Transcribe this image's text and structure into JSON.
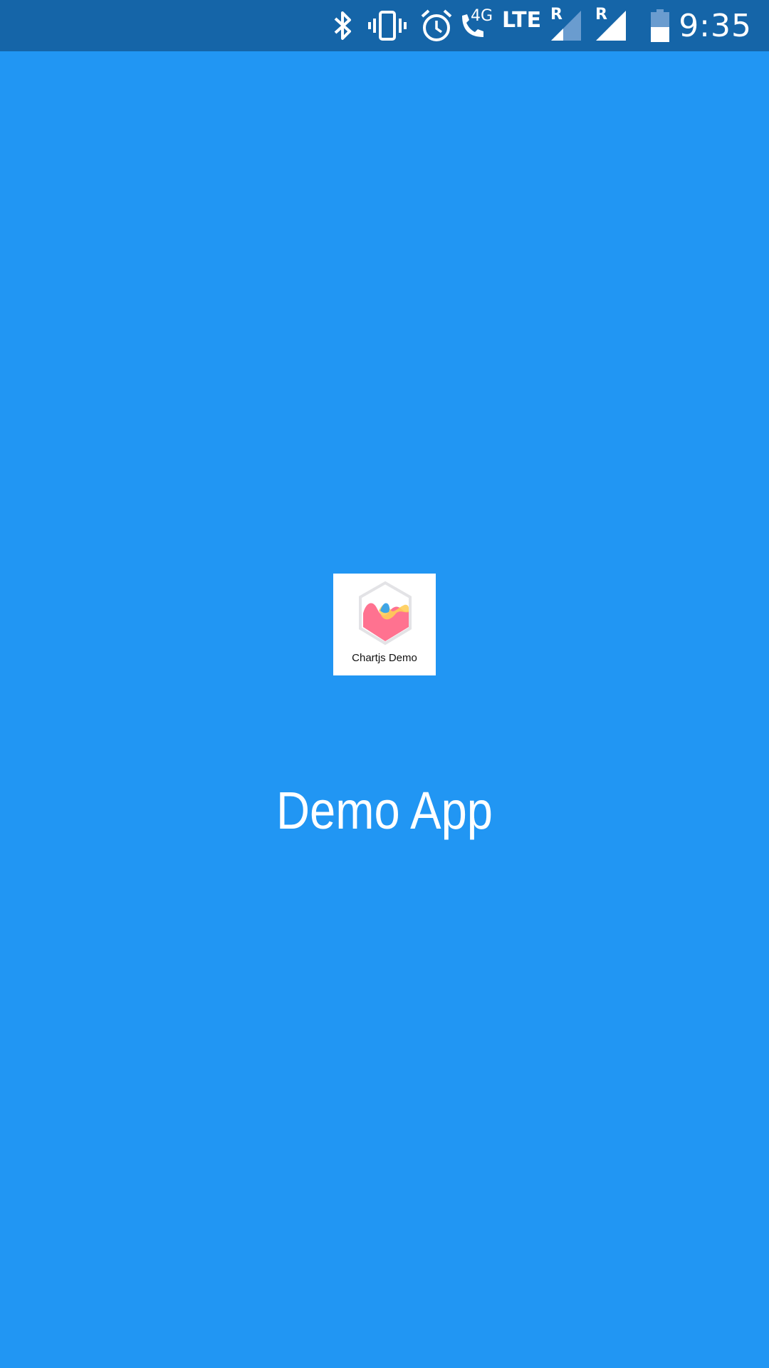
{
  "status_bar": {
    "time": "9:35",
    "network_type": "LTE",
    "call_network": "4G",
    "sim1_roaming": "R",
    "sim2_roaming": "R",
    "icons": [
      "bluetooth-icon",
      "vibrate-icon",
      "alarm-icon",
      "wifi-calling-icon",
      "signal-sim1-icon",
      "signal-sim2-icon",
      "battery-icon"
    ],
    "battery_level": 0.5,
    "sim1_signal_level": 0.4,
    "sim2_signal_level": 1.0
  },
  "splash": {
    "logo_caption": "Chartjs Demo",
    "title": "Demo App"
  },
  "colors": {
    "background": "#2196F3",
    "status_bar": "#1565A8",
    "logo_card": "#FFFFFF",
    "logo_pink": "#FF6384",
    "logo_yellow": "#FFCD56",
    "logo_blue": "#36A2EB"
  }
}
